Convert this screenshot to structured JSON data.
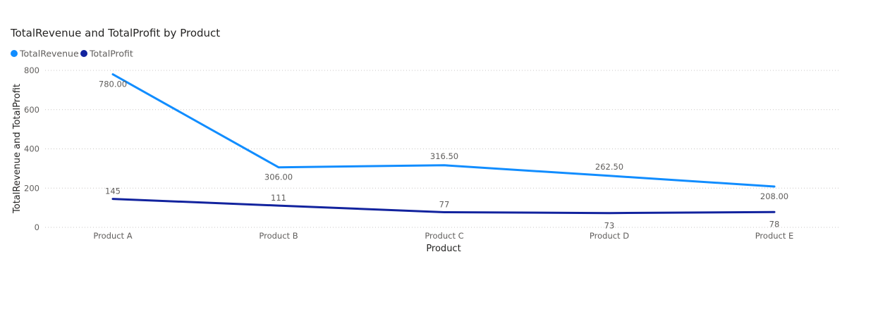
{
  "chart_data": {
    "type": "line",
    "title": "TotalRevenue and TotalProfit by Product",
    "xlabel": "Product",
    "ylabel": "TotalRevenue and TotalProfit",
    "categories": [
      "Product A",
      "Product B",
      "Product C",
      "Product D",
      "Product E"
    ],
    "ylim": [
      0,
      800
    ],
    "yticks": [
      "0",
      "200",
      "400",
      "600",
      "800"
    ],
    "grid": true,
    "legend_position": "top-left",
    "series": [
      {
        "name": "TotalRevenue",
        "color": "#118dff",
        "values": [
          780.0,
          306.0,
          316.5,
          262.5,
          208.0
        ],
        "labels": [
          "780.00",
          "306.00",
          "316.50",
          "262.50",
          "208.00"
        ]
      },
      {
        "name": "TotalProfit",
        "color": "#12239e",
        "values": [
          145,
          111,
          77,
          73,
          78
        ],
        "labels": [
          "145",
          "111",
          "77",
          "73",
          "78"
        ]
      }
    ]
  }
}
